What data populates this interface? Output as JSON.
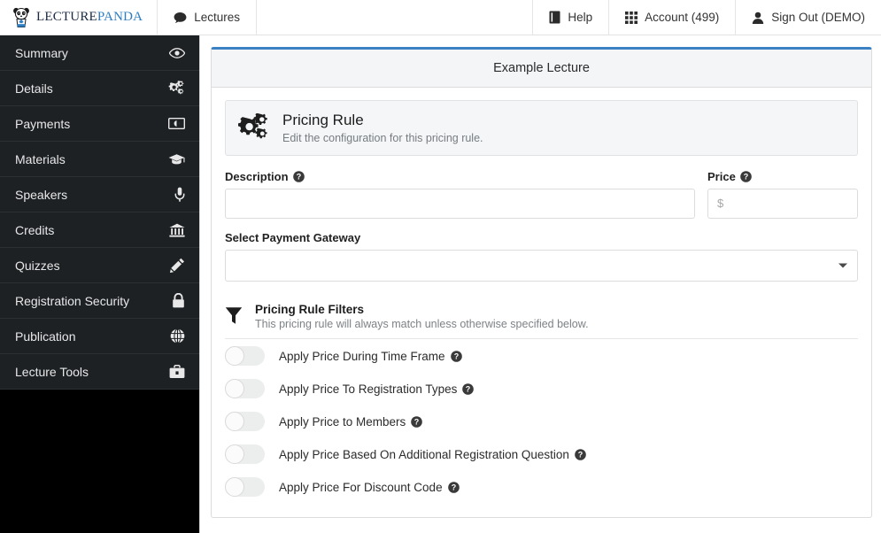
{
  "topnav": {
    "brand": {
      "word1": "Lecture",
      "word2": "Panda",
      "icon": "panda-logo"
    },
    "left_items": [
      {
        "label": "Lectures",
        "icon": "comment-icon"
      }
    ],
    "right_items": [
      {
        "label": "Help",
        "icon": "book-icon"
      },
      {
        "label": "Account (499)",
        "icon": "grid-icon"
      },
      {
        "label": "Sign Out (DEMO)",
        "icon": "user-icon"
      }
    ]
  },
  "sidebar": {
    "items": [
      {
        "label": "Summary",
        "icon": "eye-icon"
      },
      {
        "label": "Details",
        "icon": "cogs-icon"
      },
      {
        "label": "Payments",
        "icon": "money-icon"
      },
      {
        "label": "Materials",
        "icon": "graduation-cap-icon"
      },
      {
        "label": "Speakers",
        "icon": "microphone-icon"
      },
      {
        "label": "Credits",
        "icon": "bank-icon"
      },
      {
        "label": "Quizzes",
        "icon": "pencil-icon"
      },
      {
        "label": "Registration Security",
        "icon": "lock-icon"
      },
      {
        "label": "Publication",
        "icon": "globe-icon"
      },
      {
        "label": "Lecture Tools",
        "icon": "briefcase-icon"
      }
    ]
  },
  "panel": {
    "title": "Example Lecture",
    "accent_color": "#3b82c4",
    "banner": {
      "icon": "cogs-icon",
      "title": "Pricing Rule",
      "subtitle": "Edit the configuration for this pricing rule."
    },
    "form": {
      "description": {
        "label": "Description",
        "help_icon": "question-circle-icon",
        "value": "",
        "placeholder": ""
      },
      "price": {
        "label": "Price",
        "help_icon": "question-circle-icon",
        "value": "",
        "placeholder": "$"
      },
      "gateway": {
        "label": "Select Payment Gateway",
        "selected": "",
        "caret_icon": "chevron-down-icon"
      }
    },
    "filters": {
      "icon": "filter-icon",
      "title": "Pricing Rule Filters",
      "subtitle": "This pricing rule will always match unless otherwise specified below.",
      "toggles": [
        {
          "label": "Apply Price During Time Frame",
          "on": false,
          "help_icon": "question-circle-icon"
        },
        {
          "label": "Apply Price To Registration Types",
          "on": false,
          "help_icon": "question-circle-icon"
        },
        {
          "label": "Apply Price to Members",
          "on": false,
          "help_icon": "question-circle-icon"
        },
        {
          "label": "Apply Price Based On Additional Registration Question",
          "on": false,
          "help_icon": "question-circle-icon"
        },
        {
          "label": "Apply Price For Discount Code",
          "on": false,
          "help_icon": "question-circle-icon"
        }
      ]
    }
  }
}
